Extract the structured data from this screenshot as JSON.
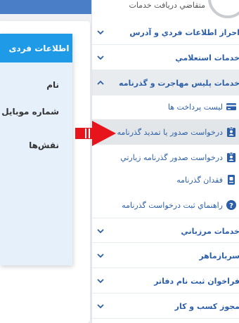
{
  "user": {
    "role_text": "متقاضي دريافت خدمات"
  },
  "info_panel": {
    "title": "اطلاعات فردی",
    "fields": [
      "نام",
      "شماره موبایل",
      "نقش‌ها"
    ]
  },
  "menu": {
    "sections_top": [
      "احراز اطلاعات فردي و آدرس",
      "خدمات استعلامي"
    ],
    "open_section": "خدمات پلیس مهاجرت و گذرنامه",
    "sub_items": [
      {
        "label": "ليست پرداخت ها",
        "icon": "card-icon"
      },
      {
        "label": "درخواست صدور يا تمديد گذرنامه",
        "icon": "id-badge-icon"
      },
      {
        "label": "درخواست صدور گذرنامه زيارتي",
        "icon": "id-badge-icon"
      },
      {
        "label": "فقدان گذرنامه",
        "icon": "passport-lost-icon"
      },
      {
        "label": "راهنماي ثبت درخواست گذرنامه",
        "icon": "help-icon"
      }
    ],
    "sections_bottom": [
      "خدمات مرزباني",
      "سربازماهر",
      "فراخوان ثبت نام دفاتر",
      "مجوز کسب و کار"
    ]
  },
  "colors": {
    "accent": "#2c5fa8",
    "header_blue": "#1e9ae6",
    "arrow_red": "#e8141b"
  }
}
